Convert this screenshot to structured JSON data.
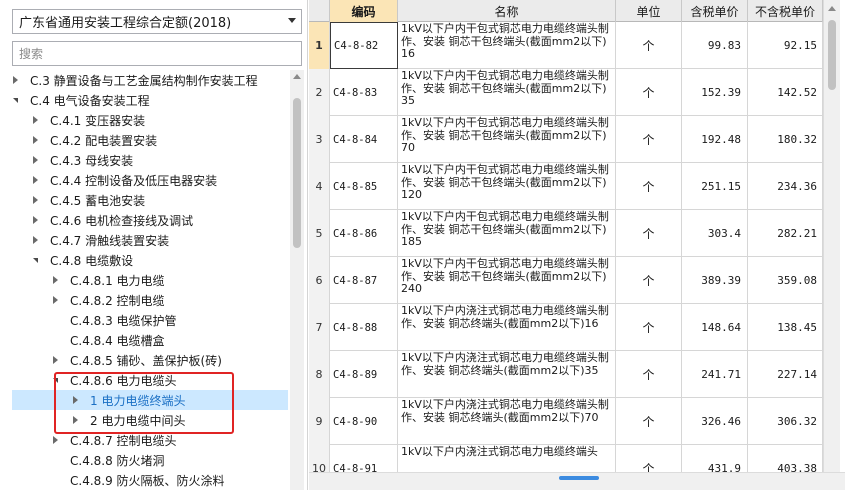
{
  "left": {
    "dropdown_value": "广东省通用安装工程综合定额(2018)",
    "search_placeholder": "搜索",
    "tree": [
      {
        "label": "C.3 静置设备与工艺金属结构制作安装工程",
        "level": 0,
        "state": "collapsed"
      },
      {
        "label": "C.4 电气设备安装工程",
        "level": 0,
        "state": "expanded"
      },
      {
        "label": "C.4.1 变压器安装",
        "level": 1,
        "state": "collapsed"
      },
      {
        "label": "C.4.2 配电装置安装",
        "level": 1,
        "state": "collapsed"
      },
      {
        "label": "C.4.3 母线安装",
        "level": 1,
        "state": "collapsed"
      },
      {
        "label": "C.4.4 控制设备及低压电器安装",
        "level": 1,
        "state": "collapsed"
      },
      {
        "label": "C.4.5 蓄电池安装",
        "level": 1,
        "state": "collapsed"
      },
      {
        "label": "C.4.6 电机检查接线及调试",
        "level": 1,
        "state": "collapsed"
      },
      {
        "label": "C.4.7 滑触线装置安装",
        "level": 1,
        "state": "collapsed"
      },
      {
        "label": "C.4.8 电缆敷设",
        "level": 1,
        "state": "expanded"
      },
      {
        "label": "C.4.8.1 电力电缆",
        "level": 2,
        "state": "collapsed"
      },
      {
        "label": "C.4.8.2 控制电缆",
        "level": 2,
        "state": "collapsed"
      },
      {
        "label": "C.4.8.3 电缆保护管",
        "level": 2,
        "state": "none"
      },
      {
        "label": "C.4.8.4 电缆槽盒",
        "level": 2,
        "state": "none"
      },
      {
        "label": "C.4.8.5 铺砂、盖保护板(砖)",
        "level": 2,
        "state": "collapsed"
      },
      {
        "label": "C.4.8.6 电力电缆头",
        "level": 2,
        "state": "expanded"
      },
      {
        "label": "1 电力电缆终端头",
        "level": 3,
        "state": "collapsed",
        "selected": true
      },
      {
        "label": "2 电力电缆中间头",
        "level": 3,
        "state": "collapsed"
      },
      {
        "label": "C.4.8.7 控制电缆头",
        "level": 2,
        "state": "collapsed"
      },
      {
        "label": "C.4.8.8 防火堵洞",
        "level": 2,
        "state": "none"
      },
      {
        "label": "C.4.8.9 防火隔板、防火涂料",
        "level": 2,
        "state": "none"
      }
    ]
  },
  "grid": {
    "columns": [
      "编码",
      "名称",
      "单位",
      "含税单价",
      "不含税单价"
    ],
    "rows": [
      {
        "index": "1",
        "code": "C4-8-82",
        "name": "1kV以下户内干包式铜芯电力电缆终端头制作、安装 铜芯干包终端头(截面mm2以下)16",
        "unit": "个",
        "tax": "99.83",
        "notax": "92.15"
      },
      {
        "index": "2",
        "code": "C4-8-83",
        "name": "1kV以下户内干包式铜芯电力电缆终端头制作、安装 铜芯干包终端头(截面mm2以下)35",
        "unit": "个",
        "tax": "152.39",
        "notax": "142.52"
      },
      {
        "index": "3",
        "code": "C4-8-84",
        "name": "1kV以下户内干包式铜芯电力电缆终端头制作、安装 铜芯干包终端头(截面mm2以下)70",
        "unit": "个",
        "tax": "192.48",
        "notax": "180.32"
      },
      {
        "index": "4",
        "code": "C4-8-85",
        "name": "1kV以下户内干包式铜芯电力电缆终端头制作、安装 铜芯干包终端头(截面mm2以下)120",
        "unit": "个",
        "tax": "251.15",
        "notax": "234.36"
      },
      {
        "index": "5",
        "code": "C4-8-86",
        "name": "1kV以下户内干包式铜芯电力电缆终端头制作、安装 铜芯干包终端头(截面mm2以下)185",
        "unit": "个",
        "tax": "303.4",
        "notax": "282.21"
      },
      {
        "index": "6",
        "code": "C4-8-87",
        "name": "1kV以下户内干包式铜芯电力电缆终端头制作、安装 铜芯干包终端头(截面mm2以下)240",
        "unit": "个",
        "tax": "389.39",
        "notax": "359.08"
      },
      {
        "index": "7",
        "code": "C4-8-88",
        "name": "1kV以下户内浇注式铜芯电力电缆终端头制作、安装 铜芯终端头(截面mm2以下)16",
        "unit": "个",
        "tax": "148.64",
        "notax": "138.45"
      },
      {
        "index": "8",
        "code": "C4-8-89",
        "name": "1kV以下户内浇注式铜芯电力电缆终端头制作、安装 铜芯终端头(截面mm2以下)35",
        "unit": "个",
        "tax": "241.71",
        "notax": "227.14"
      },
      {
        "index": "9",
        "code": "C4-8-90",
        "name": "1kV以下户内浇注式铜芯电力电缆终端头制作、安装 铜芯终端头(截面mm2以下)70",
        "unit": "个",
        "tax": "326.46",
        "notax": "306.32"
      },
      {
        "index": "10",
        "code": "C4-8-91",
        "name": "1kV以下户内浇注式铜芯电力电缆终端头",
        "unit": "个",
        "tax": "431.9",
        "notax": "403.38"
      }
    ]
  },
  "colors": {
    "selection_bg": "#cce8ff",
    "selection_text": "#1a6fc4",
    "highlight_border": "#e02424",
    "code_header_bg": "#fbe5b6"
  }
}
